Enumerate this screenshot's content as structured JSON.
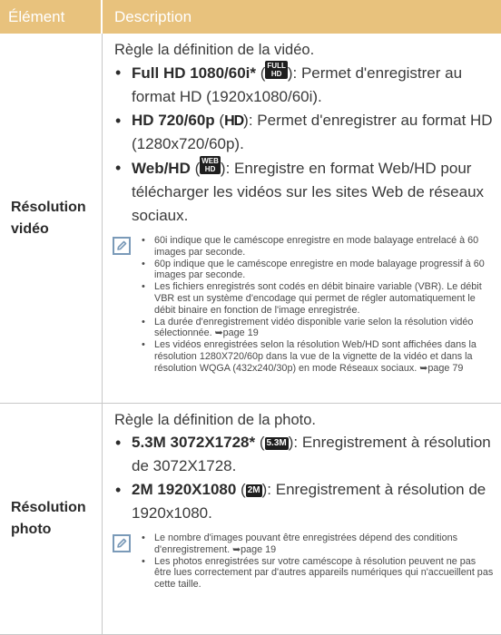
{
  "header": {
    "col1": "Élément",
    "col2": "Description"
  },
  "colors": {
    "header_bg": "#e8c27d",
    "note_icon": "#7a9ab8"
  },
  "rows": [
    {
      "label_line1": "Résolution",
      "label_line2": "vidéo",
      "intro": "Règle la définition de la vidéo.",
      "items": [
        {
          "bold": "Full HD 1080/60i*",
          "icon_text": "FULL HD",
          "icon": "full-hd-icon",
          "text": "): Permet d'enregistrer au format HD (1920x1080/60i)."
        },
        {
          "bold": "HD 720/60p",
          "icon_text": "HD",
          "icon": "hd-icon",
          "text": "): Permet d'enregistrer au format HD (1280x720/60p)."
        },
        {
          "bold": "Web/HD",
          "icon_text": "WEB HD",
          "icon": "web-hd-icon",
          "text": "): Enregistre en format Web/HD pour télécharger les vidéos sur les sites Web de réseaux sociaux."
        }
      ],
      "notes": [
        "60i indique que le caméscope enregistre en mode balayage entrelacé à 60 images par seconde.",
        "60p indique que le caméscope enregistre en mode balayage progressif à 60 images par seconde.",
        "Les fichiers enregistrés sont codés en débit binaire variable (VBR). Le débit VBR est un système d'encodage qui permet de régler automatiquement le débit binaire en fonction de l'image enregistrée.",
        "La durée d'enregistrement vidéo disponible varie selon la résolution vidéo sélectionnée. ➥page 19",
        "Les vidéos enregistrées selon la résolution Web/HD sont affichées dans la résolution 1280X720/60p dans la vue de la vignette de la vidéo et dans la résolution WQGA (432x240/30p) en mode Réseaux sociaux. ➥page 79"
      ]
    },
    {
      "label_line1": "Résolution",
      "label_line2": "photo",
      "intro": "Règle la définition de la photo.",
      "items": [
        {
          "bold": "5.3M 3072X1728*",
          "icon_text": "5.3M",
          "icon": "5-3m-icon",
          "text": "): Enregistrement à résolution de 3072X1728."
        },
        {
          "bold": "2M 1920X1080",
          "icon_text": "2M",
          "icon": "2m-icon",
          "text": "): Enregistrement à résolution de 1920x1080."
        }
      ],
      "notes": [
        "Le nombre d'images pouvant être enregistrées dépend des conditions d'enregistrement. ➥page 19",
        "Les photos enregistrées sur votre caméscope à résolution peuvent ne pas être lues correctement par d'autres appareils numériques qui n'accueillent pas cette taille."
      ]
    }
  ]
}
